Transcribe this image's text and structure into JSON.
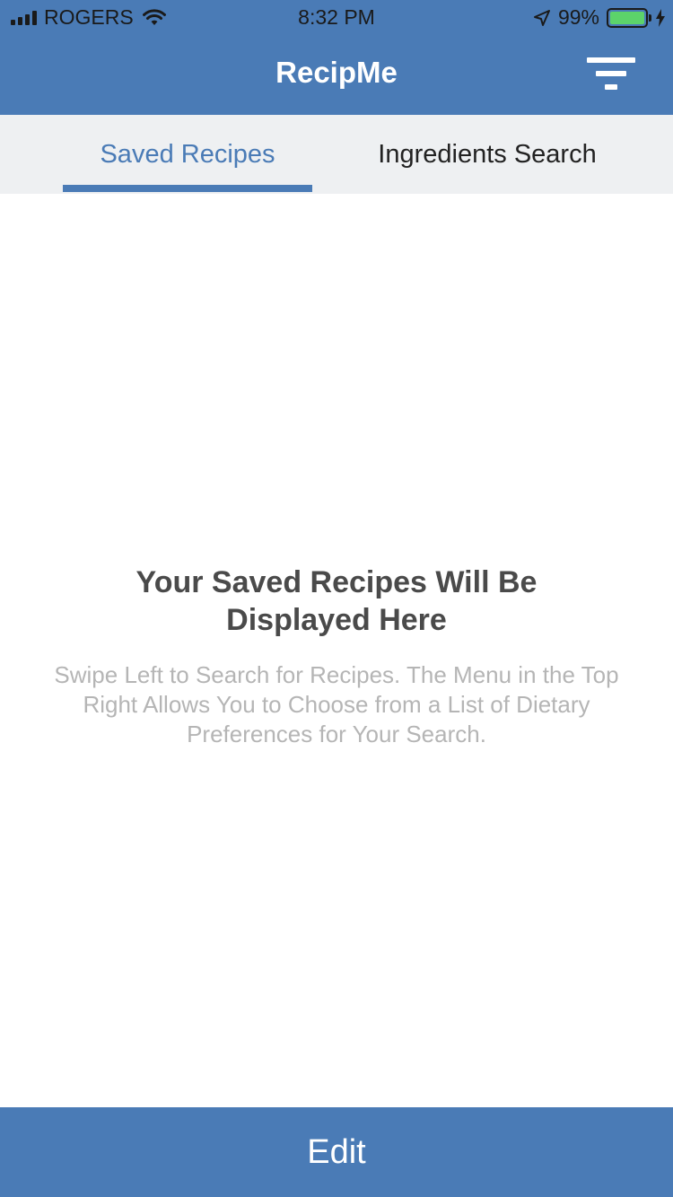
{
  "status_bar": {
    "carrier": "ROGERS",
    "time": "8:32 PM",
    "battery": "99%",
    "icons": [
      "signal-icon",
      "wifi-icon",
      "location-arrow-icon",
      "battery-icon",
      "charging-bolt-icon"
    ]
  },
  "header": {
    "title": "RecipMe",
    "filter_icon": "filter-menu-icon"
  },
  "tabs": [
    {
      "label": "Saved Recipes",
      "active": true
    },
    {
      "label": "Ingredients Search",
      "active": false
    }
  ],
  "empty_state": {
    "title": "Your Saved Recipes Will Be Displayed Here",
    "description": "Swipe Left to Search for Recipes. The Menu in the Top Right Allows You to Choose from a List of Dietary Preferences for Your Search."
  },
  "footer": {
    "edit_label": "Edit"
  },
  "colors": {
    "brand": "#4a7bb6",
    "tab_bar_bg": "#eef0f2",
    "battery_fill": "#5cd36a"
  }
}
